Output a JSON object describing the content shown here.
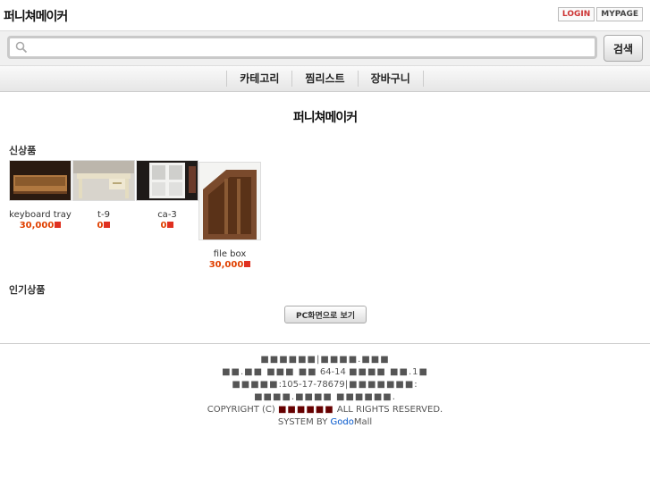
{
  "header": {
    "logo": "퍼니쳐메이커",
    "login_label": "LOGIN",
    "mypage_label": "MYPAGE"
  },
  "search": {
    "placeholder": "",
    "value": "",
    "button_label": "검색"
  },
  "nav": {
    "items": [
      {
        "label": "카테고리"
      },
      {
        "label": "찜리스트"
      },
      {
        "label": "장바구니"
      }
    ]
  },
  "main": {
    "title": "퍼니쳐메이커",
    "new_products": {
      "title": "신상품",
      "items": [
        {
          "name": "keyboard tray",
          "price": "30,000"
        },
        {
          "name": "t-9",
          "price": "0"
        },
        {
          "name": "ca-3",
          "price": "0"
        },
        {
          "name": "file box",
          "price": "30,000"
        }
      ]
    },
    "popular_products": {
      "title": "인기상품"
    },
    "pc_view_label": "PC화면으로 보기"
  },
  "footer": {
    "line1": "■■■■■■|■■■■.■■■",
    "line2_a": "■■.■■ ■■■ ■■",
    "line2_b": "64-14",
    "line2_c": "■■■■ ■■.1■",
    "line3_a": "■■■■■",
    "line3_b": ":105-17-78679",
    "line3_c": "|■■■■■■■:",
    "line4": "■■■■.■■■■ ■■■■■■.",
    "copyright_a": "COPYRIGHT (C)",
    "copyright_b": "■■■■■■",
    "copyright_c": "ALL RIGHTS RESERVED.",
    "system_a": "SYSTEM BY",
    "system_godo": "Godo",
    "system_mall": "Mall"
  },
  "colors": {
    "price": "#e04000",
    "login": "#cc3333",
    "godo": "#0055cc"
  }
}
